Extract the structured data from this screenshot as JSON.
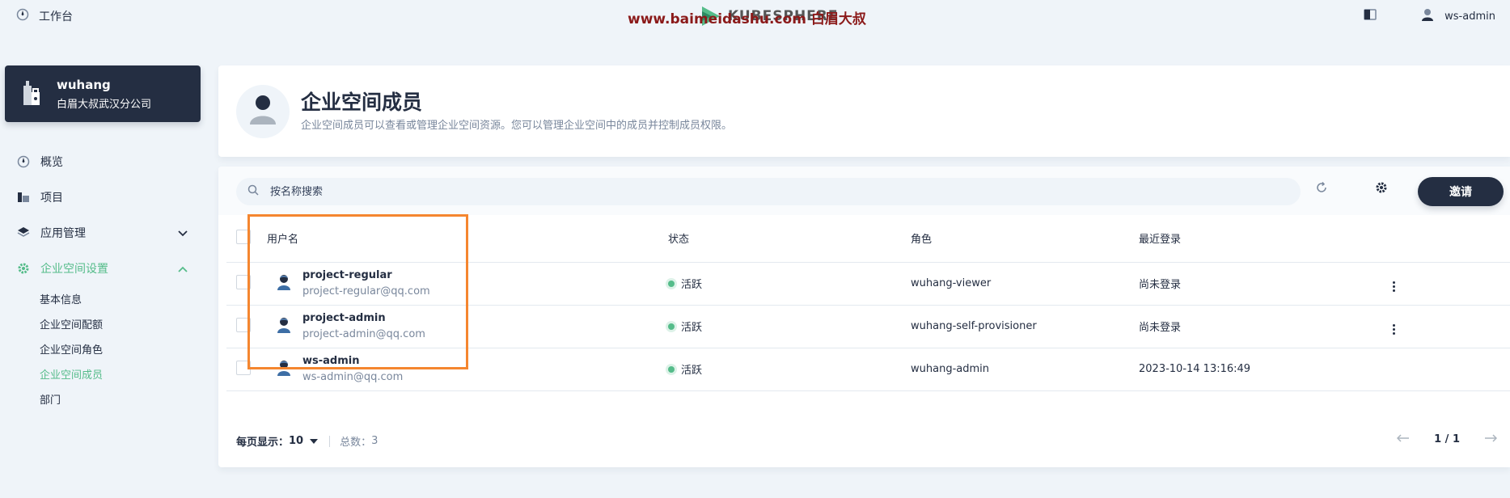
{
  "topbar": {
    "workbench_label": "工作台",
    "logo_text": "KUBESPHERE",
    "watermark": "www.baimeidashu.com 白眉大叔",
    "user_name": "ws-admin"
  },
  "workspace": {
    "name": "wuhang",
    "description": "白眉大叔武汉分公司"
  },
  "nav": {
    "overview": "概览",
    "projects": "项目",
    "app_management": "应用管理",
    "settings": "企业空间设置",
    "settings_items": [
      "基本信息",
      "企业空间配额",
      "企业空间角色",
      "企业空间成员",
      "部门"
    ],
    "active_item": "企业空间成员"
  },
  "banner": {
    "title": "企业空间成员",
    "subtitle": "企业空间成员可以查看或管理企业空间资源。您可以管理企业空间中的成员并控制成员权限。"
  },
  "toolbar": {
    "search_placeholder": "按名称搜索",
    "invite_label": "邀请"
  },
  "table": {
    "columns": [
      "用户名",
      "状态",
      "角色",
      "最近登录"
    ],
    "rows": [
      {
        "name": "project-regular",
        "email": "project-regular@qq.com",
        "status": "活跃",
        "role": "wuhang-viewer",
        "last_login": "尚未登录"
      },
      {
        "name": "project-admin",
        "email": "project-admin@qq.com",
        "status": "活跃",
        "role": "wuhang-self-provisioner",
        "last_login": "尚未登录"
      },
      {
        "name": "ws-admin",
        "email": "ws-admin@qq.com",
        "status": "活跃",
        "role": "wuhang-admin",
        "last_login": "2023-10-14 13:16:49"
      }
    ]
  },
  "pagination": {
    "per_page_label": "每页显示：",
    "per_page_value": "10",
    "total_label": "总数：",
    "total_value": "3",
    "page_indicator": "1 / 1"
  },
  "colors": {
    "accent": "#55bc8a",
    "dark": "#242e42",
    "highlight": "#f5862f"
  }
}
